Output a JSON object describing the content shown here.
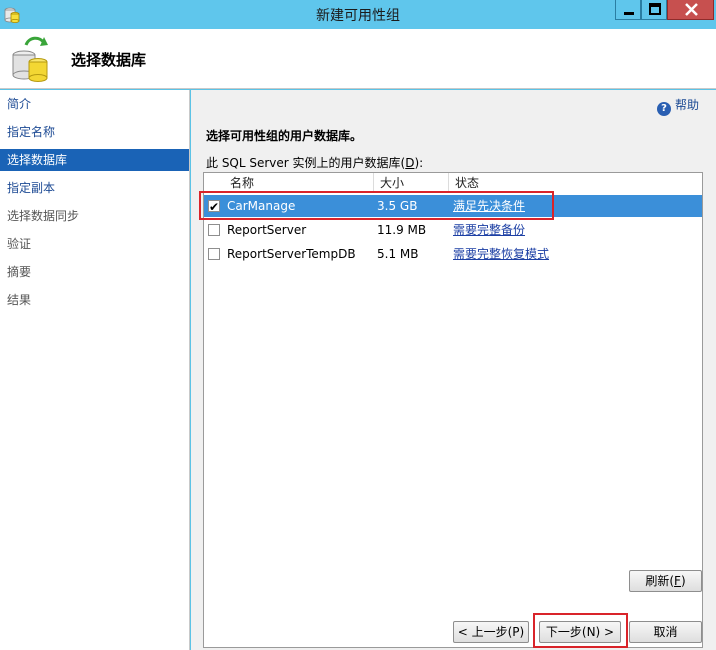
{
  "window": {
    "title": "新建可用性组",
    "min_glyph": "—",
    "close_glyph": "✕"
  },
  "header": {
    "title": "选择数据库"
  },
  "nav": {
    "items": [
      {
        "label": "简介",
        "state": "link"
      },
      {
        "label": "指定名称",
        "state": "link"
      },
      {
        "label": "选择数据库",
        "state": "selected"
      },
      {
        "label": "指定副本",
        "state": "link"
      },
      {
        "label": "选择数据同步",
        "state": "disabled"
      },
      {
        "label": "验证",
        "state": "disabled"
      },
      {
        "label": "摘要",
        "state": "disabled"
      },
      {
        "label": "结果",
        "state": "disabled"
      }
    ]
  },
  "main": {
    "help_label": "帮助",
    "instruction": "选择可用性组的用户数据库。",
    "list_label_pre": "此 SQL Server 实例上的用户数据库(",
    "list_label_key": "D",
    "list_label_post": "):",
    "columns": [
      "名称",
      "大小",
      "状态"
    ],
    "rows": [
      {
        "name": "CarManage",
        "size": "3.5 GB",
        "status": "满足先决条件",
        "checked": true,
        "selected": true
      },
      {
        "name": "ReportServer",
        "size": "11.9 MB",
        "status": "需要完整备份",
        "checked": false,
        "selected": false
      },
      {
        "name": "ReportServerTempDB",
        "size": "5.1 MB",
        "status": "需要完整恢复模式",
        "checked": false,
        "selected": false
      }
    ]
  },
  "buttons": {
    "refresh_pre": "刷新(",
    "refresh_key": "F",
    "refresh_post": ")",
    "prev": "< 上一步(P)",
    "next": "下一步(N) >",
    "cancel": "取消"
  },
  "colors": {
    "titlebar": "#5fc6ec",
    "nav_selected": "#1a63b6",
    "row_selected": "#3b8fd9",
    "highlight": "#d9242a"
  }
}
